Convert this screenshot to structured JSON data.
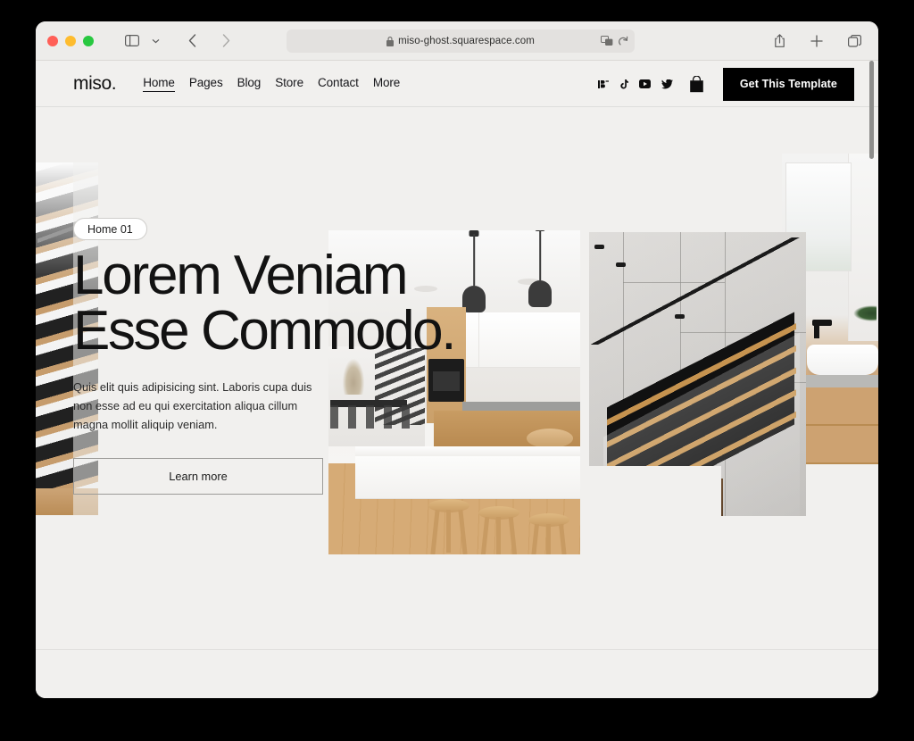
{
  "browser": {
    "traffic_lights": [
      "close",
      "minimize",
      "maximize"
    ],
    "url": "miso-ghost.squarespace.com",
    "secure": true,
    "toolbar_icons": [
      "sidebar-icon",
      "chevron-down-icon",
      "back-icon",
      "forward-icon",
      "translate-icon",
      "reload-icon",
      "share-icon",
      "new-tab-icon",
      "tab-overview-icon"
    ]
  },
  "site": {
    "logo": "miso.",
    "nav": [
      {
        "label": "Home",
        "active": true
      },
      {
        "label": "Pages",
        "active": false
      },
      {
        "label": "Blog",
        "active": false
      },
      {
        "label": "Store",
        "active": false
      },
      {
        "label": "Contact",
        "active": false
      },
      {
        "label": "More",
        "active": false
      }
    ],
    "social": [
      "behance-icon",
      "tiktok-icon",
      "youtube-icon",
      "twitter-icon"
    ],
    "cart": "shopping-bag-icon",
    "cta": "Get This Template"
  },
  "hero": {
    "badge": "Home 01",
    "title_line1": "Lorem Veniam",
    "title_line2": "Esse Commodo.",
    "paragraph": "Quis elit quis adipisicing sint. Laboris cupa duis non esse ad eu qui exercitation aliqua cillum magna mollit aliquip veniam.",
    "button": "Learn more",
    "images": [
      {
        "name": "staircase-left",
        "alt": "Dark metal and wood staircase"
      },
      {
        "name": "kitchen-center",
        "alt": "Modern white kitchen with pendant lights and wooden stools"
      },
      {
        "name": "staircase-right",
        "alt": "Wooden treads staircase against concrete wall"
      },
      {
        "name": "bathroom-right",
        "alt": "Bathroom with vessel sink and wooden vanity"
      }
    ]
  },
  "colors": {
    "page_bg": "#f1f0ee",
    "text": "#121212",
    "cta_bg": "#000000",
    "cta_text": "#ffffff",
    "border": "#dededc",
    "traffic_red": "#ff5f57",
    "traffic_yellow": "#febc2e",
    "traffic_green": "#28c840"
  }
}
